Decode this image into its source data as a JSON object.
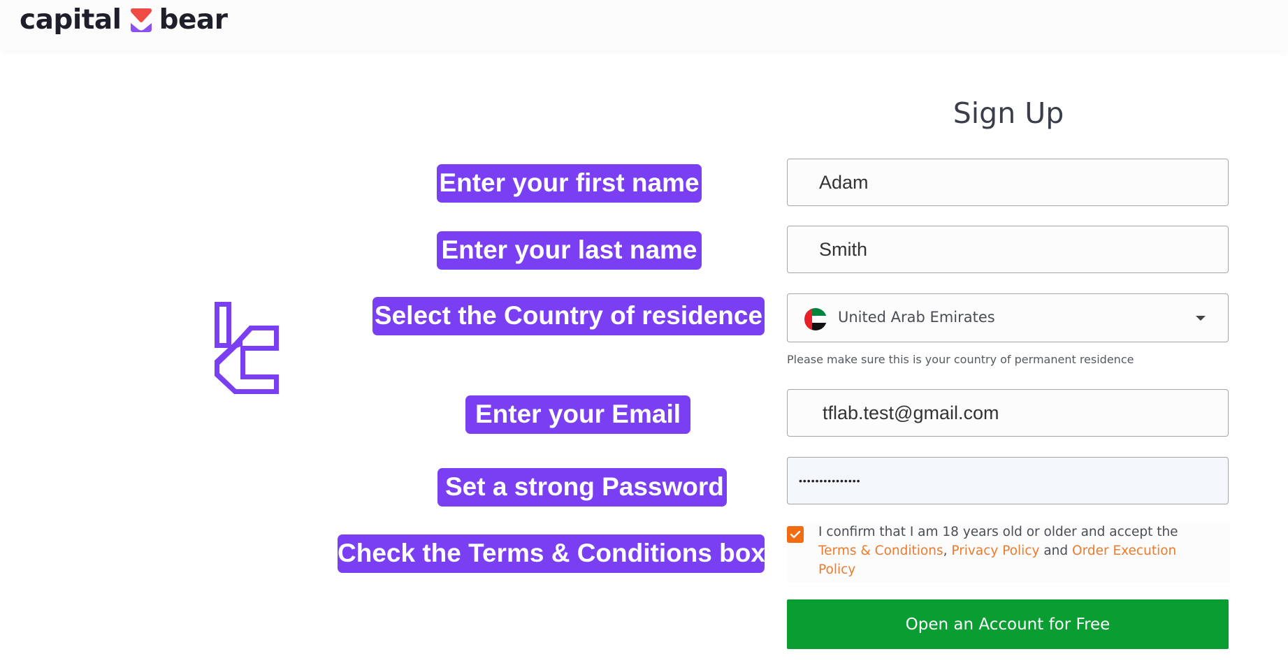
{
  "header": {
    "logo_left": "capital",
    "logo_right": "bear",
    "logo_icon": "capital-bear-logo-icon"
  },
  "colors": {
    "callout_purple": "#7a3ff2",
    "brand_red": "#f04a45",
    "brand_purple": "#8c4ff0",
    "checkbox_orange": "#f26b12",
    "link_orange": "#ed7a2d",
    "submit_green": "#099d32"
  },
  "form": {
    "title": "Sign Up",
    "first_name": "Adam",
    "last_name": "Smith",
    "country": {
      "value": "United Arab Emirates",
      "flag_icon": "uae-flag-icon",
      "helper": "Please make sure this is your country of permanent residence"
    },
    "email": "tflab.test@gmail.com",
    "password": "•••••••••••••••",
    "consent": {
      "checked": true,
      "text_before": "I confirm that I am 18 years old or older and accept the ",
      "link_terms": "Terms & Conditions",
      "sep_comma": ", ",
      "link_privacy": "Privacy Policy",
      "sep_and": " and ",
      "link_order": "Order Execution Policy"
    },
    "submit_label": "Open an Account for Free"
  },
  "callouts": [
    "Enter your first name",
    "Enter your last name",
    "Select the Country of residence",
    "Enter your Email",
    "Set a strong Password",
    "Check the Terms & Conditions box"
  ]
}
